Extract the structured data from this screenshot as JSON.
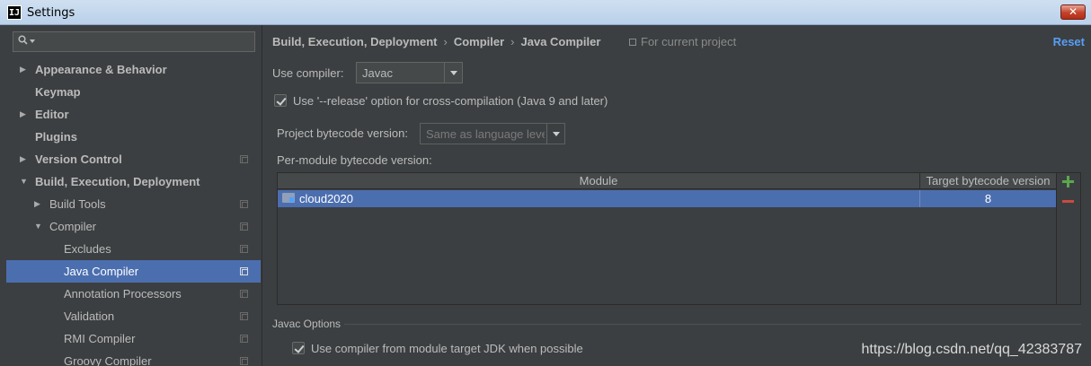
{
  "window": {
    "title": "Settings",
    "app_icon_text": "IJ",
    "close_glyph": "✕"
  },
  "sidebar": {
    "search": {
      "value": "",
      "placeholder": ""
    },
    "items": [
      {
        "label": "Appearance & Behavior",
        "level": 0,
        "expanded": false,
        "has_arrow": true,
        "bold": true,
        "project": false
      },
      {
        "label": "Keymap",
        "level": 0,
        "has_arrow": false,
        "bold": true,
        "project": false
      },
      {
        "label": "Editor",
        "level": 0,
        "expanded": false,
        "has_arrow": true,
        "bold": true,
        "project": false
      },
      {
        "label": "Plugins",
        "level": 0,
        "has_arrow": false,
        "bold": true,
        "project": false
      },
      {
        "label": "Version Control",
        "level": 0,
        "expanded": false,
        "has_arrow": true,
        "bold": true,
        "project": true
      },
      {
        "label": "Build, Execution, Deployment",
        "level": 0,
        "expanded": true,
        "has_arrow": true,
        "bold": true,
        "project": false
      },
      {
        "label": "Build Tools",
        "level": 1,
        "expanded": false,
        "has_arrow": true,
        "bold": false,
        "project": true
      },
      {
        "label": "Compiler",
        "level": 1,
        "expanded": true,
        "has_arrow": true,
        "bold": false,
        "project": true
      },
      {
        "label": "Excludes",
        "level": 2,
        "has_arrow": false,
        "bold": false,
        "project": true
      },
      {
        "label": "Java Compiler",
        "level": 2,
        "has_arrow": false,
        "bold": false,
        "project": true,
        "selected": true
      },
      {
        "label": "Annotation Processors",
        "level": 2,
        "has_arrow": false,
        "bold": false,
        "project": true
      },
      {
        "label": "Validation",
        "level": 2,
        "has_arrow": false,
        "bold": false,
        "project": true
      },
      {
        "label": "RMI Compiler",
        "level": 2,
        "has_arrow": false,
        "bold": false,
        "project": true
      },
      {
        "label": "Groovy Compiler",
        "level": 2,
        "has_arrow": false,
        "bold": false,
        "project": true
      }
    ]
  },
  "header": {
    "breadcrumb": [
      "Build, Execution, Deployment",
      "Compiler",
      "Java Compiler"
    ],
    "breadcrumb_separator": "›",
    "scope_note": "For current project",
    "reset_label": "Reset"
  },
  "form": {
    "use_compiler_label": "Use compiler:",
    "use_compiler_value": "Javac",
    "release_option_label": "Use '--release' option for cross-compilation (Java 9 and later)",
    "release_option_checked": true,
    "project_bytecode_label": "Project bytecode version:",
    "project_bytecode_value": "Same as language level",
    "per_module_label": "Per-module bytecode version:"
  },
  "module_table": {
    "columns": [
      "Module",
      "Target bytecode version"
    ],
    "rows": [
      {
        "module": "cloud2020",
        "target": "8",
        "selected": true
      }
    ]
  },
  "javac_options": {
    "section_title": "Javac Options",
    "module_jdk_label": "Use compiler from module target JDK when possible",
    "module_jdk_checked": true
  },
  "watermark": "https://blog.csdn.net/qq_42383787",
  "colors": {
    "accent": "#589df6",
    "selection": "#4b6eaf",
    "add": "#5aa84d",
    "remove": "#c94b3f"
  }
}
